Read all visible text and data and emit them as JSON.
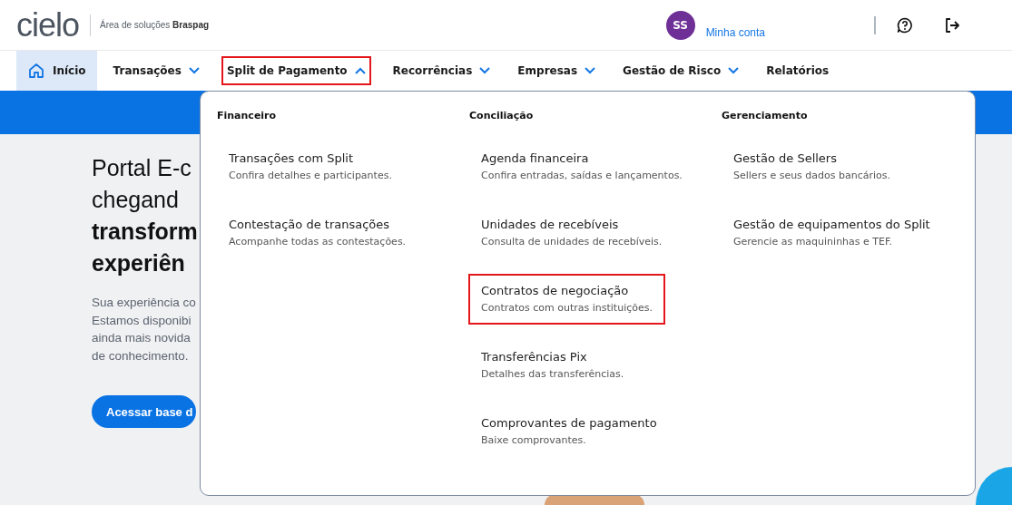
{
  "header": {
    "logo": "cielo",
    "subtitle": "Área de soluções **Braspag**",
    "avatar_initials": "SS",
    "account_link": "Minha conta"
  },
  "nav": [
    {
      "label": "Início",
      "kind": "home",
      "selected": true,
      "highlighted": false
    },
    {
      "label": "Transações",
      "kind": "menu",
      "selected": false,
      "expanded": false,
      "highlighted": false
    },
    {
      "label": "Split de Pagamento",
      "kind": "menu",
      "selected": false,
      "expanded": true,
      "highlighted": true
    },
    {
      "label": "Recorrências",
      "kind": "menu",
      "selected": false,
      "expanded": false,
      "highlighted": false
    },
    {
      "label": "Empresas",
      "kind": "menu",
      "selected": false,
      "expanded": false,
      "highlighted": false
    },
    {
      "label": "Gestão de Risco",
      "kind": "menu",
      "selected": false,
      "expanded": false,
      "highlighted": false
    },
    {
      "label": "Relatórios",
      "kind": "link",
      "selected": false,
      "highlighted": false
    }
  ],
  "hero": {
    "heading_lines": [
      {
        "text": "Portal E-c",
        "bold": false
      },
      {
        "text": "chegand",
        "bold": false
      },
      {
        "text": "transform",
        "bold": true
      },
      {
        "text": "experiên",
        "bold": true
      }
    ],
    "paragraph_lines": [
      "Sua experiência co",
      "Estamos disponibi",
      "ainda mais novida",
      "de conhecimento."
    ],
    "button": "Acessar base d"
  },
  "dropdown": {
    "columns": [
      {
        "heading": "Financeiro",
        "items": [
          {
            "title": "Transações com Split",
            "description": "Confira detalhes e participantes.",
            "highlighted": false
          },
          {
            "title": "Contestação de transações",
            "description": "Acompanhe todas as contestações.",
            "highlighted": false
          }
        ]
      },
      {
        "heading": "Conciliação",
        "items": [
          {
            "title": "Agenda financeira",
            "description": "Confira entradas, saídas e lançamentos.",
            "highlighted": false
          },
          {
            "title": "Unidades de recebíveis",
            "description": "Consulta de unidades de recebíveis.",
            "highlighted": false
          },
          {
            "title": "Contratos de negociação",
            "description": "Contratos com outras instituições.",
            "highlighted": true
          },
          {
            "title": "Transferências Pix",
            "description": "Detalhes das transferências.",
            "highlighted": false
          },
          {
            "title": "Comprovantes de pagamento",
            "description": "Baixe comprovantes.",
            "highlighted": false
          }
        ]
      },
      {
        "heading": "Gerenciamento",
        "items": [
          {
            "title": "Gestão de Sellers",
            "description": "Sellers e seus dados bancários.",
            "highlighted": false
          },
          {
            "title": "Gestão de equipamentos do Split",
            "description": "Gerencie as maquininhas e TEF.",
            "highlighted": false
          }
        ]
      }
    ]
  }
}
